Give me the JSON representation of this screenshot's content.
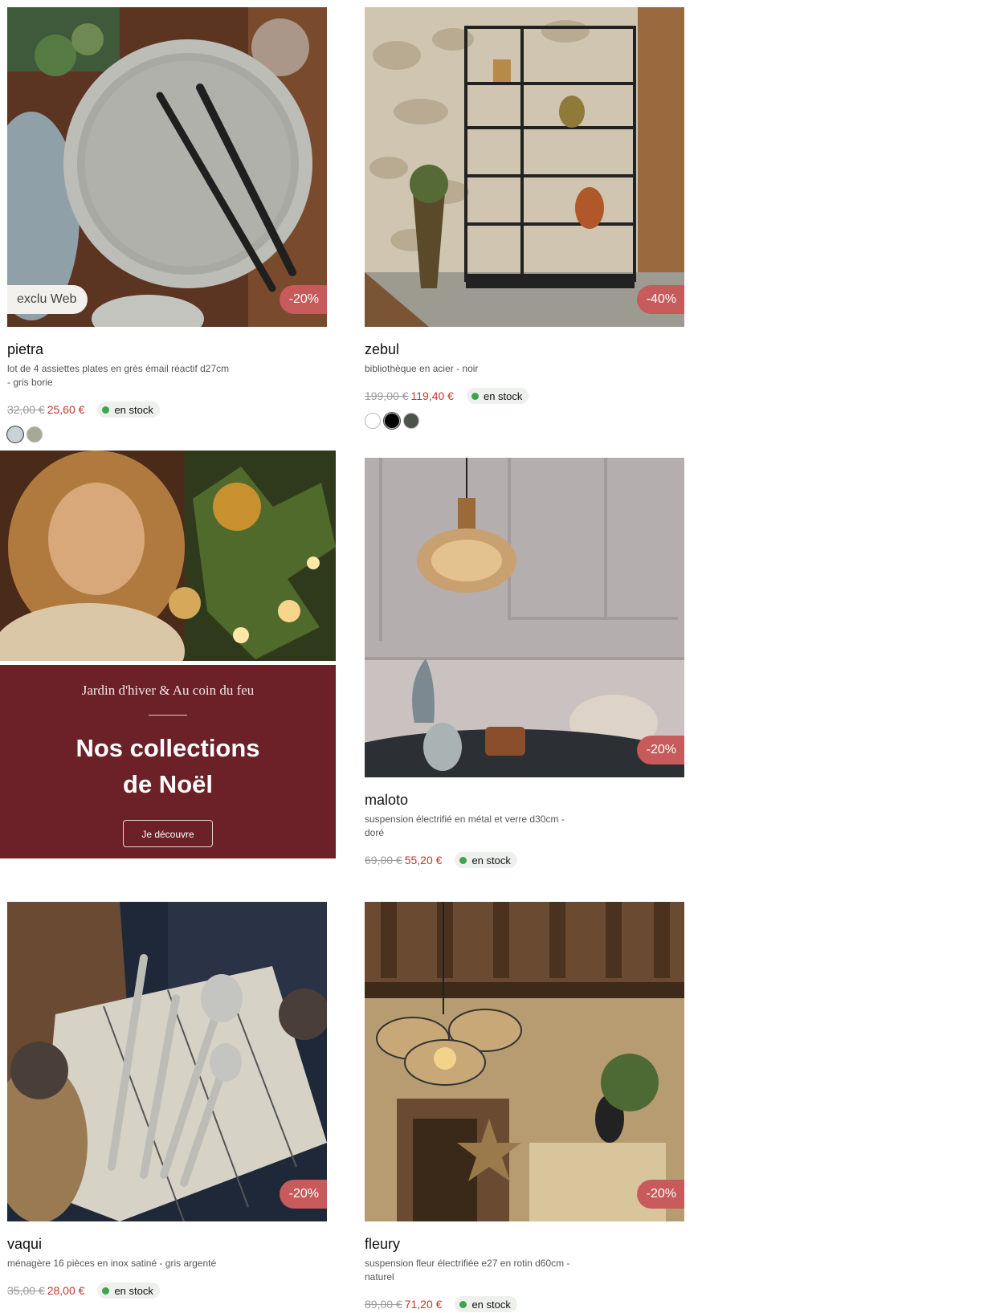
{
  "products": [
    {
      "name": "pietra",
      "desc_line1": "lot de 4 assiettes plates en grès émail réactif d27cm",
      "desc_line2": "- gris borie",
      "old_price": "32,00 €",
      "new_price": "25,60 €",
      "stock": "en stock",
      "discount": "-20%",
      "badge": "exclu Web",
      "swatches": [
        "#c9d3d6",
        "#a7a898"
      ]
    },
    {
      "name": "zebul",
      "desc_line1": "bibliothèque en acier - noir",
      "old_price": "199,00 €",
      "new_price": "119,40 €",
      "stock": "en stock",
      "discount": "-40%",
      "swatches": [
        "#ffffff",
        "#000000",
        "#4d524d"
      ]
    },
    {
      "name": "maloto",
      "desc_line1": "suspension électrifié en métal et verre d30cm -",
      "desc_line2": "doré",
      "old_price": "69,00 €",
      "new_price": "55,20 €",
      "stock": "en stock",
      "discount": "-20%"
    },
    {
      "name": "vaqui",
      "desc_line1": "ménagère 16 pièces en inox satiné - gris argenté",
      "old_price": "35,00 €",
      "new_price": "28,00 €",
      "stock": "en stock",
      "discount": "-20%"
    },
    {
      "name": "fleury",
      "desc_line1": "suspension fleur électrifiée e27 en rotin d60cm -",
      "desc_line2": "naturel",
      "old_price": "89,00 €",
      "new_price": "71,20 €",
      "stock": "en stock",
      "discount": "-20%"
    }
  ],
  "promo": {
    "subtitle": "Jardin d'hiver & Au coin du feu",
    "title_line1": "Nos collections",
    "title_line2": "de Noël",
    "button": "Je découvre"
  }
}
